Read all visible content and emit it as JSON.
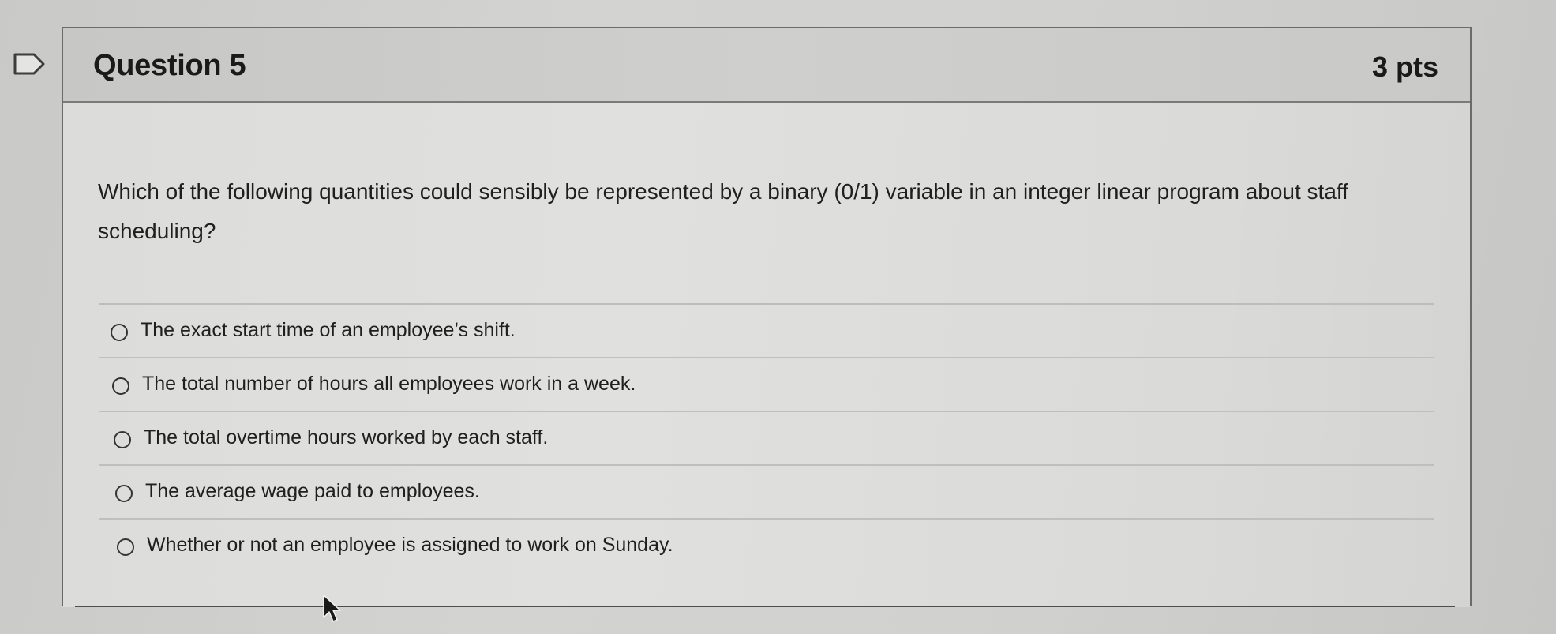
{
  "question": {
    "title": "Question 5",
    "points": "3 pts",
    "prompt": "Which of the following quantities could sensibly be represented by a binary (0/1) variable in an integer linear program about staff scheduling?"
  },
  "answers": [
    {
      "label": "The exact start time of an employee’s shift."
    },
    {
      "label": "The total number of hours all employees work in a week."
    },
    {
      "label": "The total overtime hours worked by each staff."
    },
    {
      "label": "The average wage paid to employees."
    },
    {
      "label": "Whether or not an employee is assigned to work on Sunday."
    }
  ],
  "icons": {
    "flag": "flag-icon",
    "radio": "radio-unselected-icon",
    "cursor": "mouse-pointer-icon"
  },
  "colors": {
    "text": "#1f1f1f",
    "border": "#6b6b6b",
    "header_bg": "#cacac8",
    "body_bg": "#dcdcda"
  }
}
